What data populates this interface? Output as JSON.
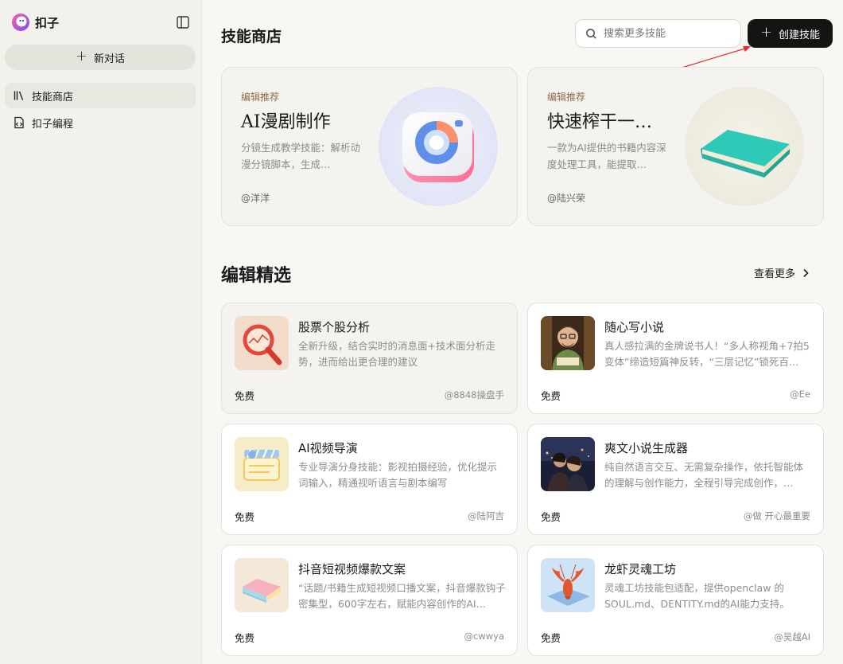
{
  "brand": {
    "name": "扣子"
  },
  "sidebar": {
    "new_chat_label": "新对话",
    "items": [
      {
        "label": "技能商店",
        "active": true
      },
      {
        "label": "扣子编程",
        "active": false
      }
    ]
  },
  "header": {
    "title": "技能商店",
    "search_placeholder": "搜索更多技能",
    "create_label": "创建技能"
  },
  "recommended": [
    {
      "tag": "编辑推荐",
      "title": "AI漫剧制作",
      "desc": "分镜生成教学技能：解析动漫分镜脚本，生成…",
      "author": "@洋洋"
    },
    {
      "tag": "编辑推荐",
      "title": "快速榨干一…",
      "desc": "一款为AI提供的书籍内容深度处理工具，能提取…",
      "author": "@陆兴荣"
    }
  ],
  "featured": {
    "title": "编辑精选",
    "see_more": "查看更多",
    "skills": [
      {
        "name": "股票个股分析",
        "desc": "全新升级，结合实时的消息面+技术面分析走势，进而给出更合理的建议",
        "price": "免费",
        "author": "@8848操盘手"
      },
      {
        "name": "随心写小说",
        "desc": "真人感拉满的金牌说书人！“多人称视角+7拍5变体”缔造短篇神反转，“三层记忆”锁死百…",
        "price": "免费",
        "author": "@Ee"
      },
      {
        "name": "AI视频导演",
        "desc": "专业导演分身技能：影视拍摄经验，优化提示词输入，精通视听语言与剧本编写",
        "price": "免费",
        "author": "@陆阿吉"
      },
      {
        "name": "爽文小说生成器",
        "desc": "纯自然语言交互、无需复杂操作，依托智能体的理解与创作能力，全程引导完成创作，…",
        "price": "免费",
        "author": "@做 开心最重要"
      },
      {
        "name": "抖音短视频爆款文案",
        "desc": "“话题/书籍生成短视频口播文案，抖音爆款钩子密集型，600字左右，赋能内容创作的AI…",
        "price": "免费",
        "author": "@cwwya"
      },
      {
        "name": "龙虾灵魂工坊",
        "desc": "灵魂工坊技能包适配，提供openclaw 的SOUL.md、DENTITY.md的AI能力支持。",
        "price": "免费",
        "author": "@吴越AI"
      }
    ]
  }
}
